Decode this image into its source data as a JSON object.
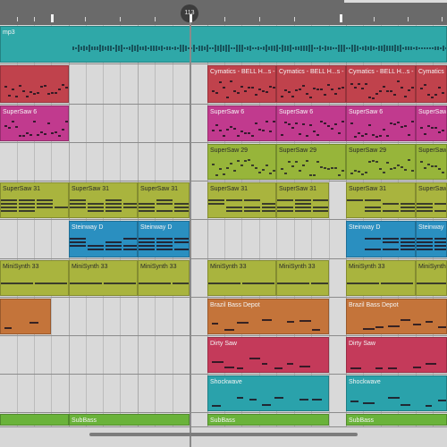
{
  "ruler": {
    "playhead_value": "113",
    "major_ticks": [
      57,
      212,
      380
    ],
    "minor_ticks": [
      19,
      38,
      95,
      134,
      173,
      251,
      290,
      329,
      418,
      456,
      494
    ]
  },
  "colors": {
    "background": "#d9d9d9",
    "cyan": "#2fa8a8",
    "red": "#c0424c",
    "magenta": "#c13a8e",
    "lime": "#97b53a",
    "olive": "#a9b43e",
    "blue": "#2a8fc0",
    "orange": "#c4743a",
    "crimson": "#c43a5a",
    "teal": "#2aa2ab",
    "green": "#6ab33a"
  },
  "tracks": [
    {
      "name": "audio",
      "color": "#2fa8a8",
      "regions": [
        {
          "label": "mp3",
          "start": 0,
          "end": 500,
          "kind": "audio"
        }
      ]
    },
    {
      "name": "cymatics",
      "color": "#c0424c",
      "regions": [
        {
          "label": "",
          "start": 0,
          "end": 77,
          "kind": "midi"
        },
        {
          "label": "Cymatics - BELL H...s - C",
          "start": 232,
          "end": 309,
          "kind": "midi"
        },
        {
          "label": "Cymatics - BELL H...s - C",
          "start": 309,
          "end": 387,
          "kind": "midi"
        },
        {
          "label": "Cymatics - BELL H...s - C",
          "start": 387,
          "end": 465,
          "kind": "midi"
        },
        {
          "label": "Cymatics - BELL H...s - C",
          "start": 465,
          "end": 500,
          "kind": "midi"
        }
      ]
    },
    {
      "name": "supersaw6",
      "color": "#c13a8e",
      "regions": [
        {
          "label": "SuperSaw 6",
          "start": 0,
          "end": 77,
          "kind": "midi"
        },
        {
          "label": "SuperSaw 6",
          "start": 232,
          "end": 309,
          "kind": "midi"
        },
        {
          "label": "SuperSaw 6",
          "start": 309,
          "end": 387,
          "kind": "midi"
        },
        {
          "label": "SuperSaw 6",
          "start": 387,
          "end": 465,
          "kind": "midi"
        },
        {
          "label": "SuperSaw 6",
          "start": 465,
          "end": 500,
          "kind": "midi"
        }
      ]
    },
    {
      "name": "supersaw29",
      "color": "#97b53a",
      "regions": [
        {
          "label": "SuperSaw 29",
          "start": 232,
          "end": 309,
          "kind": "midi"
        },
        {
          "label": "SuperSaw 29",
          "start": 309,
          "end": 387,
          "kind": "midi"
        },
        {
          "label": "SuperSaw 29",
          "start": 387,
          "end": 465,
          "kind": "midi"
        },
        {
          "label": "SuperSaw 2",
          "start": 465,
          "end": 500,
          "kind": "midi"
        }
      ]
    },
    {
      "name": "supersaw31",
      "color": "#a9b43e",
      "regions": [
        {
          "label": "SuperSaw 31",
          "start": 0,
          "end": 77,
          "kind": "chord"
        },
        {
          "label": "SuperSaw 31",
          "start": 77,
          "end": 154,
          "kind": "chord"
        },
        {
          "label": "SuperSaw 31",
          "start": 154,
          "end": 212,
          "kind": "chord"
        },
        {
          "label": "SuperSaw 31",
          "start": 232,
          "end": 309,
          "kind": "chord"
        },
        {
          "label": "SuperSaw 31",
          "start": 309,
          "end": 368,
          "kind": "chord"
        },
        {
          "label": "SuperSaw 31",
          "start": 387,
          "end": 465,
          "kind": "chord"
        },
        {
          "label": "SuperSaw 31",
          "start": 465,
          "end": 500,
          "kind": "chord"
        }
      ]
    },
    {
      "name": "steinway",
      "color": "#2a8fc0",
      "regions": [
        {
          "label": "Steinway D",
          "start": 77,
          "end": 154,
          "kind": "chord"
        },
        {
          "label": "Steinway D",
          "start": 154,
          "end": 212,
          "kind": "chord"
        },
        {
          "label": "Steinway D",
          "start": 387,
          "end": 465,
          "kind": "chord"
        },
        {
          "label": "Steinway D",
          "start": 465,
          "end": 500,
          "kind": "chord"
        }
      ]
    },
    {
      "name": "minisynth",
      "color": "#a9b43e",
      "regions": [
        {
          "label": "MiniSynth 33",
          "start": 0,
          "end": 77,
          "kind": "bass"
        },
        {
          "label": "MiniSynth 33",
          "start": 77,
          "end": 154,
          "kind": "bass"
        },
        {
          "label": "MiniSynth 33",
          "start": 154,
          "end": 212,
          "kind": "bass"
        },
        {
          "label": "MiniSynth 33",
          "start": 232,
          "end": 309,
          "kind": "bass"
        },
        {
          "label": "MiniSynth 33",
          "start": 309,
          "end": 368,
          "kind": "bass"
        },
        {
          "label": "MiniSynth 33",
          "start": 387,
          "end": 465,
          "kind": "bass"
        },
        {
          "label": "MiniSynth 33",
          "start": 465,
          "end": 500,
          "kind": "bass"
        }
      ]
    },
    {
      "name": "brazil",
      "color": "#c4743a",
      "regions": [
        {
          "label": "",
          "start": 0,
          "end": 57,
          "kind": "sparse"
        },
        {
          "label": "Brazil Bass Depot",
          "start": 232,
          "end": 368,
          "kind": "sparse"
        },
        {
          "label": "Brazil Bass Depot",
          "start": 387,
          "end": 500,
          "kind": "sparse"
        }
      ]
    },
    {
      "name": "dirtysaw",
      "color": "#c43a5a",
      "regions": [
        {
          "label": "Dirty Saw",
          "start": 232,
          "end": 368,
          "kind": "sparse"
        },
        {
          "label": "Dirty Saw",
          "start": 387,
          "end": 500,
          "kind": "sparse"
        }
      ]
    },
    {
      "name": "shockwave",
      "color": "#2aa2ab",
      "regions": [
        {
          "label": "Shockwave",
          "start": 232,
          "end": 368,
          "kind": "sparse"
        },
        {
          "label": "Shockwave",
          "start": 387,
          "end": 500,
          "kind": "sparse"
        }
      ]
    },
    {
      "name": "subbass",
      "color": "#6ab33a",
      "regions": [
        {
          "label": "",
          "start": 0,
          "end": 77,
          "kind": "none"
        },
        {
          "label": "SubBass",
          "start": 77,
          "end": 212,
          "kind": "none"
        },
        {
          "label": "SubBass",
          "start": 232,
          "end": 368,
          "kind": "none"
        },
        {
          "label": "SubBass",
          "start": 387,
          "end": 500,
          "kind": "none"
        }
      ]
    }
  ]
}
